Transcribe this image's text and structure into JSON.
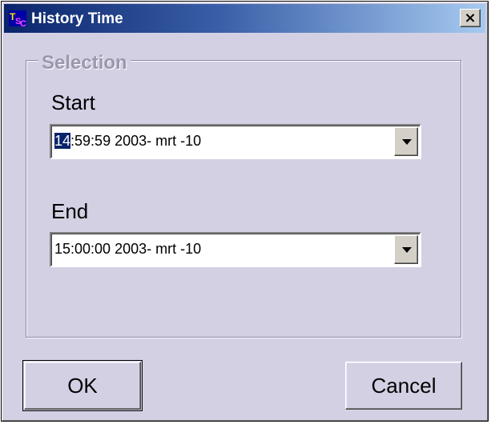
{
  "window": {
    "title": "History Time",
    "icon": "tsc-app-icon",
    "icon_text": {
      "t": "T",
      "s": "S",
      "c": "C"
    },
    "close_label": "×",
    "title_gradient": [
      "#0a246a",
      "#a6caf0"
    ],
    "background": "#d4d0e4"
  },
  "selection": {
    "group_label": "Selection",
    "start": {
      "label": "Start",
      "value_highlighted": "14",
      "value_rest": ":59:59 2003- mrt -10"
    },
    "end": {
      "label": "End",
      "value": "15:00:00 2003- mrt -10"
    }
  },
  "buttons": {
    "ok_label": "OK",
    "cancel_label": "Cancel"
  }
}
